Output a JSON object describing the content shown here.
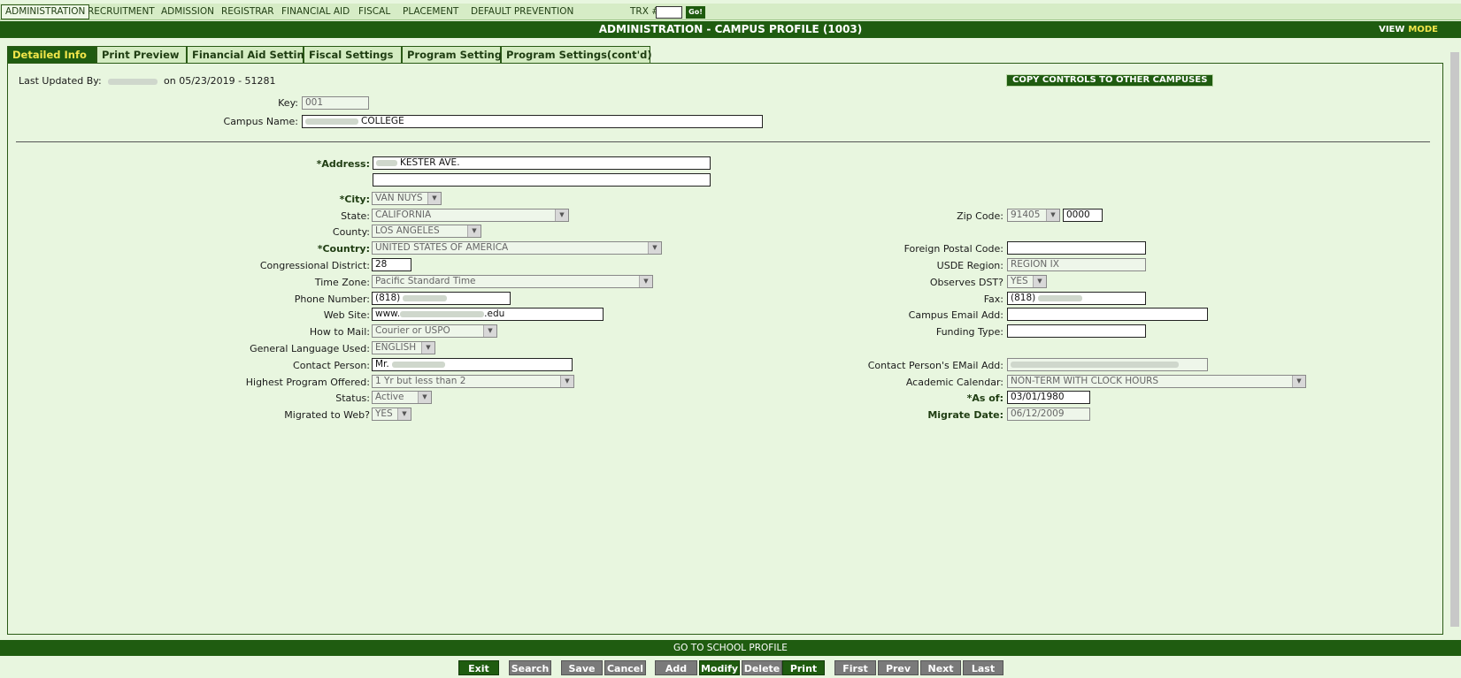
{
  "menu": {
    "items": [
      "ADMINISTRATION",
      "RECRUITMENT",
      "ADMISSION",
      "REGISTRAR",
      "FINANCIAL AID",
      "FISCAL",
      "PLACEMENT",
      "DEFAULT PREVENTION"
    ],
    "trx_label": "TRX #:",
    "go_label": "Go!"
  },
  "title": {
    "text": "ADMINISTRATION - CAMPUS PROFILE (1003)",
    "view": "VIEW",
    "mode": "MODE"
  },
  "tabs": [
    "Detailed Info",
    "Print Preview",
    "Financial Aid Settings",
    "Fiscal Settings",
    "Program Settings",
    "Program Settings(cont'd)"
  ],
  "header": {
    "last_updated_label": "Last Updated By:",
    "last_updated_on": "on 05/23/2019 - 51281",
    "copy_button": "COPY CONTROLS TO OTHER CAMPUSES",
    "key_label": "Key:",
    "key_value": "001",
    "campus_name_label": "Campus Name:",
    "campus_name_value": "COLLEGE"
  },
  "form": {
    "address_label": "*Address:",
    "address_value": "KESTER AVE.",
    "city_label": "*City:",
    "city_value": "VAN NUYS",
    "state_label": "State:",
    "state_value": "CALIFORNIA",
    "county_label": "County:",
    "county_value": "LOS ANGELES",
    "country_label": "*Country:",
    "country_value": "UNITED STATES OF AMERICA",
    "congressional_label": "Congressional District:",
    "congressional_value": "28",
    "timezone_label": "Time Zone:",
    "timezone_value": "Pacific Standard Time",
    "phone_label": "Phone Number:",
    "phone_value": "(818)",
    "website_label": "Web Site:",
    "website_prefix": "www.",
    "website_suffix": ".edu",
    "howtomail_label": "How to Mail:",
    "howtomail_value": "Courier or USPO",
    "language_label": "General Language Used:",
    "language_value": "ENGLISH",
    "contact_label": "Contact Person:",
    "contact_value": "Mr.",
    "highest_program_label": "Highest Program Offered:",
    "highest_program_value": "1 Yr but less than 2",
    "status_label": "Status:",
    "status_value": "Active",
    "migrated_label": "Migrated to Web?",
    "migrated_value": "YES",
    "zip_label": "Zip Code:",
    "zip_value": "91405",
    "zip_ext_value": "0000",
    "foreign_postal_label": "Foreign Postal Code:",
    "usde_label": "USDE Region:",
    "usde_value": "REGION IX",
    "dst_label": "Observes DST?",
    "dst_value": "YES",
    "fax_label": "Fax:",
    "fax_value": "(818)",
    "campus_email_label": "Campus Email Add:",
    "funding_label": "Funding Type:",
    "contact_email_label": "Contact Person's EMail Add:",
    "academic_cal_label": "Academic Calendar:",
    "academic_cal_value": "NON-TERM WITH CLOCK HOURS",
    "asof_label": "*As of:",
    "asof_value": "03/01/1980",
    "migrate_date_label": "Migrate Date:",
    "migrate_date_value": "06/12/2009"
  },
  "footer": {
    "school_profile": "GO TO SCHOOL PROFILE",
    "buttons": [
      "Exit",
      "Search",
      "Save",
      "Cancel",
      "Add",
      "Modify",
      "Delete",
      "Print",
      "First",
      "Prev",
      "Next",
      "Last"
    ]
  }
}
